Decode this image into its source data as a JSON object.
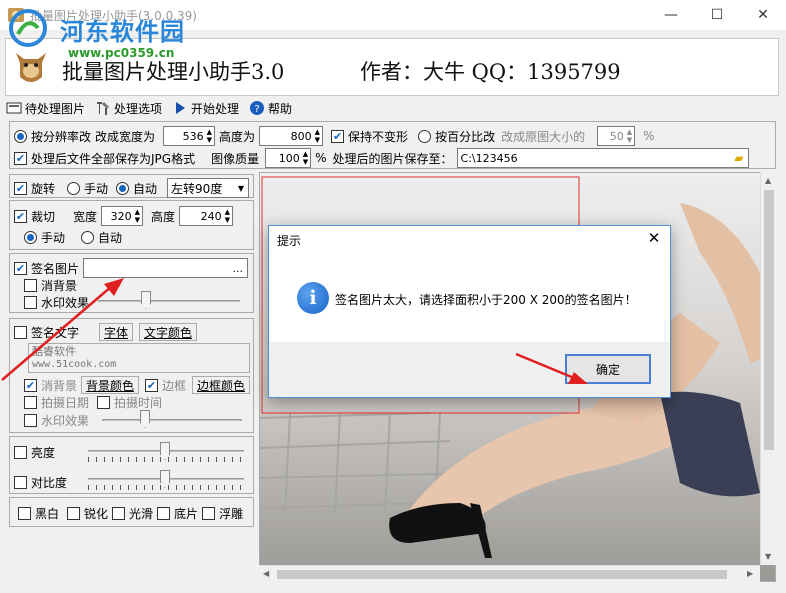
{
  "window": {
    "title": "批量图片处理小助手(3.0.0.39)",
    "min_glyph": "—",
    "max_glyph": "☐",
    "close_glyph": "✕"
  },
  "watermark": {
    "site": "河东软件园",
    "url": "www.pc0359.cn"
  },
  "banner": {
    "app_name": "批量图片处理小助手3.0",
    "author": "作者：大牛 QQ：1395799"
  },
  "toolbar": {
    "items": [
      {
        "label": "待处理图片",
        "icon": "image-list-icon"
      },
      {
        "label": "处理选项",
        "icon": "tools-icon"
      },
      {
        "label": "开始处理",
        "icon": "play-icon"
      },
      {
        "label": "帮助",
        "icon": "help-icon"
      }
    ]
  },
  "options": {
    "by_resolution": "按分辨率改",
    "width_label": "改成宽度为",
    "width_value": "536",
    "height_label": "高度为",
    "height_value": "800",
    "keep_aspect": "保持不变形",
    "by_percent": "按百分比改",
    "percent_label": "改成原图大小的",
    "percent_value": "50",
    "percent_unit": "%",
    "save_jpg": "处理后文件全部保存为JPG格式",
    "quality_label": "图像质量",
    "quality_value": "100",
    "quality_unit": "%",
    "save_to_label": "处理后的图片保存至：",
    "save_path": "C:\\123456"
  },
  "rotate": {
    "label": "旋转",
    "manual": "手动",
    "auto": "自动",
    "direction": "左转90度"
  },
  "crop": {
    "label": "裁切",
    "width_label": "宽度",
    "width_value": "320",
    "height_label": "高度",
    "height_value": "240",
    "manual": "手动",
    "auto": "自动"
  },
  "signature_image": {
    "label": "签名图片",
    "browse": "...",
    "remove_bg": "消背景",
    "watermark": "水印效果"
  },
  "signature_text": {
    "label": "签名文字",
    "font_btn": "字体",
    "color_btn": "文字颜色",
    "text_line1": "酷睿软件",
    "text_line2": "www.51cook.com",
    "remove_bg": "消背景",
    "bg_color_btn": "背景颜色",
    "border": "边框",
    "border_color_btn": "边框颜色",
    "shoot_date": "拍摄日期",
    "shoot_time": "拍摄时间",
    "watermark": "水印效果"
  },
  "adjust": {
    "brightness": "亮度",
    "contrast": "对比度"
  },
  "effects": [
    "黑白",
    "锐化",
    "光滑",
    "底片",
    "浮雕"
  ],
  "dialog": {
    "title": "提示",
    "message": "签名图片太大，请选择面积小于200 X 200的签名图片！",
    "ok": "确定",
    "close_glyph": "✕",
    "info_glyph": "i"
  },
  "colors": {
    "accent": "#1565c0",
    "annotation_arrow": "#e02020",
    "dialog_border": "#4d8fd3"
  }
}
